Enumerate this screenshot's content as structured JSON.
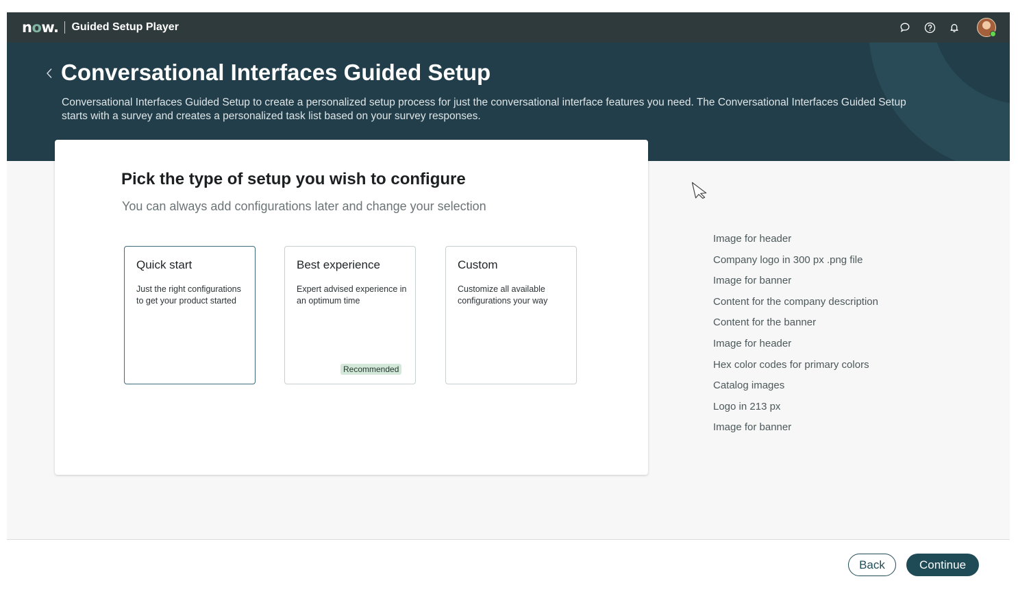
{
  "topbar": {
    "logo_text": "now",
    "app_title": "Guided Setup Player",
    "icons": [
      "chat-icon",
      "help-icon",
      "notification-bell-icon",
      "user-avatar"
    ]
  },
  "hero": {
    "title": "Conversational Interfaces Guided Setup",
    "description": "Conversational Interfaces Guided Setup to create a personalized setup process for just the conversational interface features you need. The Conversational Interfaces Guided Setup starts with a survey and creates a personalized task list based on your survey responses."
  },
  "card": {
    "title": "Pick the type of setup you wish to configure",
    "subtitle": "You can always add configurations later and change your selection",
    "options": [
      {
        "title": "Quick start",
        "description": "Just the right configurations to get your product started",
        "selected": true
      },
      {
        "title": "Best experience",
        "description": "Expert advised experience in an optimum time",
        "badge": "Recommended"
      },
      {
        "title": "Custom",
        "description": "Customize all available configurations your way"
      }
    ]
  },
  "assets": [
    "Image for header",
    "Company logo in 300 px .png file",
    "Image for banner",
    "Content for the company description",
    "Content for the banner",
    "Image for header",
    "Hex color codes for primary colors",
    "Catalog images",
    "Logo in 213 px",
    "Image for banner"
  ],
  "footer": {
    "back_label": "Back",
    "continue_label": "Continue"
  },
  "colors": {
    "topbar": "#2f3a3c",
    "hero": "#213e4a",
    "accent": "#1f4b57",
    "badge": "#d3e8d9",
    "logo_accent": "#81b5a1"
  }
}
